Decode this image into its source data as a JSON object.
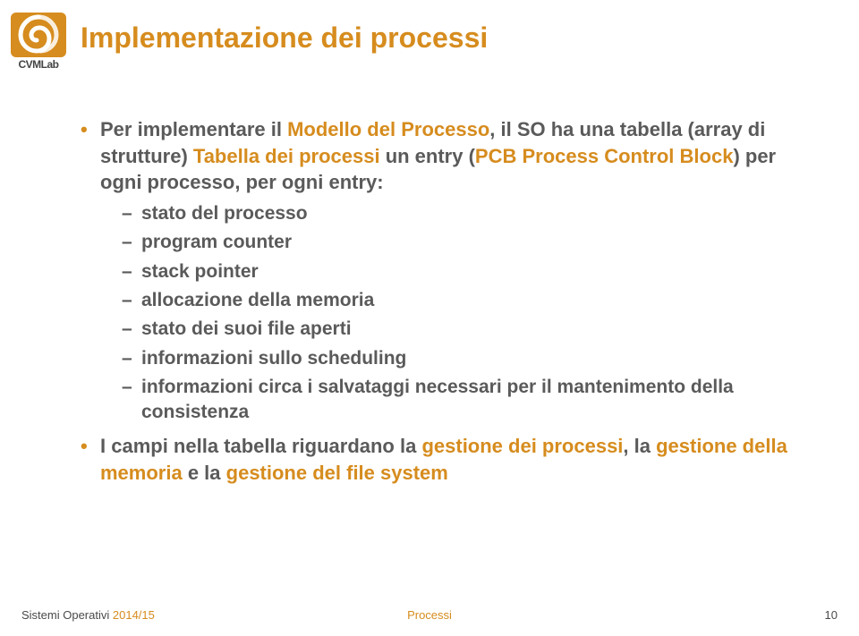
{
  "logo_text": "CVMLab",
  "title": "Implementazione dei processi",
  "bullets": [
    {
      "segments": [
        {
          "t": "Per implementare il ",
          "c": "normal"
        },
        {
          "t": "Modello del Processo",
          "c": "accent"
        },
        {
          "t": ", il SO ha una tabella (array di strutture) ",
          "c": "normal"
        },
        {
          "t": "Tabella dei processi",
          "c": "accent"
        },
        {
          "t": " un entry (",
          "c": "normal"
        },
        {
          "t": "PCB Process Control Block",
          "c": "accent"
        },
        {
          "t": ") per ogni processo, per ogni entry:",
          "c": "normal"
        }
      ],
      "children": [
        "stato del processo",
        "program counter",
        "stack pointer",
        "allocazione della memoria",
        "stato dei suoi file aperti",
        "informazioni sullo scheduling",
        "informazioni circa i salvataggi necessari per il mantenimento della consistenza"
      ]
    },
    {
      "segments": [
        {
          "t": "I campi nella tabella riguardano la ",
          "c": "normal"
        },
        {
          "t": "gestione dei processi",
          "c": "accent"
        },
        {
          "t": ", la ",
          "c": "normal"
        },
        {
          "t": "gestione della memoria",
          "c": "accent"
        },
        {
          "t": " e la ",
          "c": "normal"
        },
        {
          "t": "gestione del file system",
          "c": "accent"
        }
      ],
      "children": []
    }
  ],
  "footer": {
    "left1": "Sistemi Operativi ",
    "left2": "2014/15",
    "center": "Processi",
    "right": "10"
  }
}
